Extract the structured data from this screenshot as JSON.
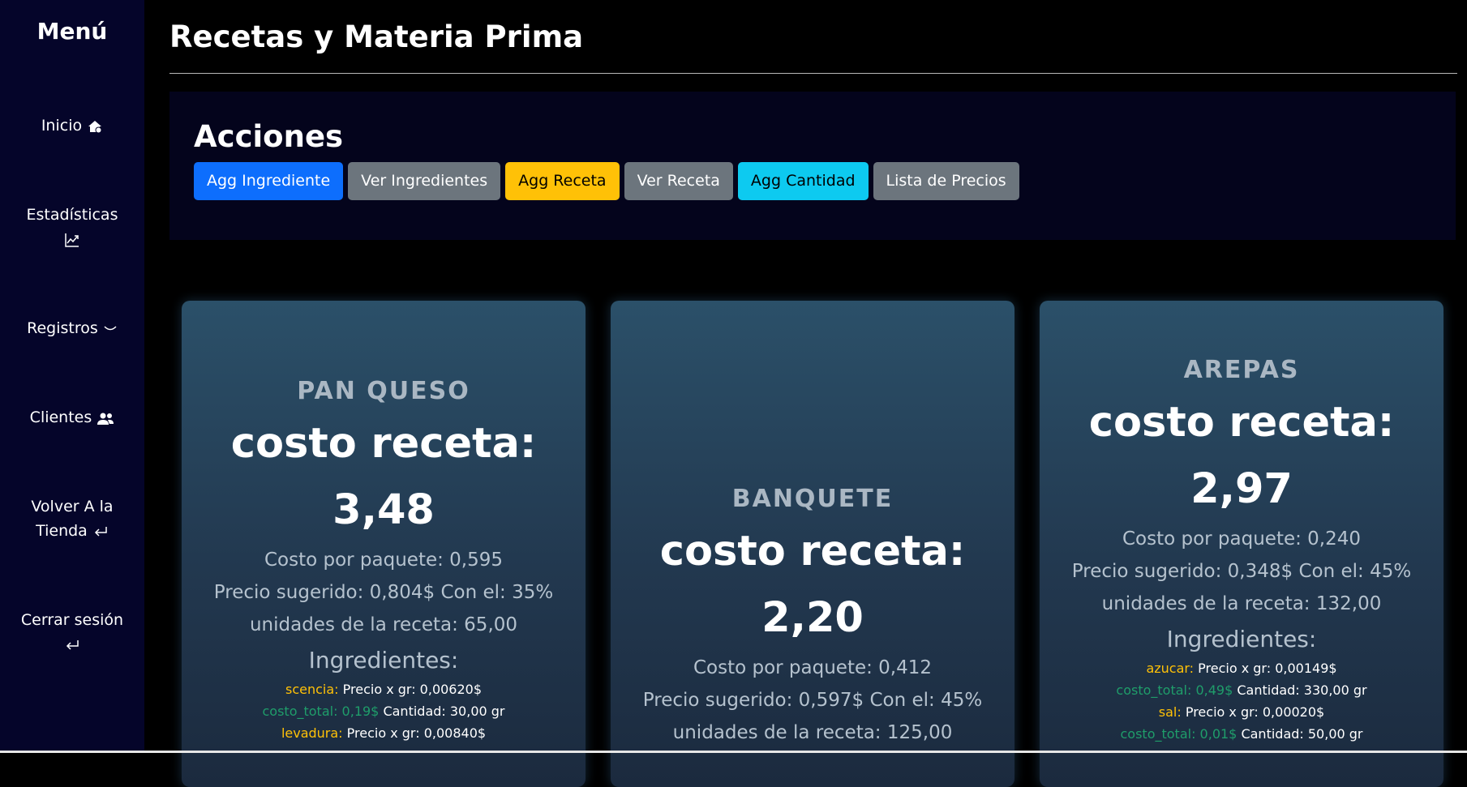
{
  "sidebar": {
    "title": "Menú",
    "items": [
      {
        "label": "Inicio",
        "icon": "home-icon"
      },
      {
        "label": "Estadísticas",
        "icon": "chart-line-icon"
      },
      {
        "label": "Registros",
        "icon": "chevron-down-icon"
      },
      {
        "label": "Clientes",
        "icon": "users-icon"
      },
      {
        "label": "Volver A la Tienda",
        "icon": "return-icon"
      },
      {
        "label": "Cerrar sesión",
        "icon": "return-icon"
      }
    ]
  },
  "header": {
    "title": "Recetas y Materia Prima"
  },
  "actions": {
    "title": "Acciones",
    "buttons": [
      {
        "label": "Agg Ingrediente",
        "color": "#0d6efd"
      },
      {
        "label": "Ver Ingredientes",
        "color": "#6c757d"
      },
      {
        "label": "Agg Receta",
        "color": "#ffc107"
      },
      {
        "label": "Ver Receta",
        "color": "#6c757d"
      },
      {
        "label": "Agg Cantidad",
        "color": "#0dcaf0"
      },
      {
        "label": "Lista de Precios",
        "color": "#6c757d"
      }
    ]
  },
  "recipes": [
    {
      "name": "PAN QUESO",
      "cost_label": "costo receta:",
      "cost": "3,48",
      "package_cost": "Costo por paquete: 0,595",
      "suggested_price": "Precio sugerido: 0,804$ Con el: 35%",
      "units": "unidades de la receta: 65,00",
      "ingredients_title": "Ingredientes:",
      "ingredients": [
        {
          "name": "scencia:",
          "detail": " Precio x gr: 0,00620$"
        },
        {
          "total": "costo_total: 0,19$",
          "detail": " Cantidad: 30,00 gr"
        },
        {
          "name": "levadura:",
          "detail": " Precio x gr: 0,00840$"
        }
      ]
    },
    {
      "name": "BANQUETE",
      "cost_label": "costo receta:",
      "cost": "2,20",
      "package_cost": "Costo por paquete: 0,412",
      "suggested_price": "Precio sugerido: 0,597$ Con el: 45%",
      "units": "unidades de la receta: 125,00"
    },
    {
      "name": "AREPAS",
      "cost_label": "costo receta:",
      "cost": "2,97",
      "package_cost": "Costo por paquete: 0,240",
      "suggested_price": "Precio sugerido: 0,348$ Con el: 45%",
      "units": "unidades de la receta: 132,00",
      "ingredients_title": "Ingredientes:",
      "ingredients": [
        {
          "name": "azucar:",
          "detail": " Precio x gr: 0,00149$"
        },
        {
          "total": "costo_total: 0,49$",
          "detail": " Cantidad: 330,00 gr"
        },
        {
          "name": "sal:",
          "detail": " Precio x gr: 0,00020$"
        },
        {
          "total": "costo_total: 0,01$",
          "detail": " Cantidad: 50,00 gr"
        }
      ]
    }
  ]
}
